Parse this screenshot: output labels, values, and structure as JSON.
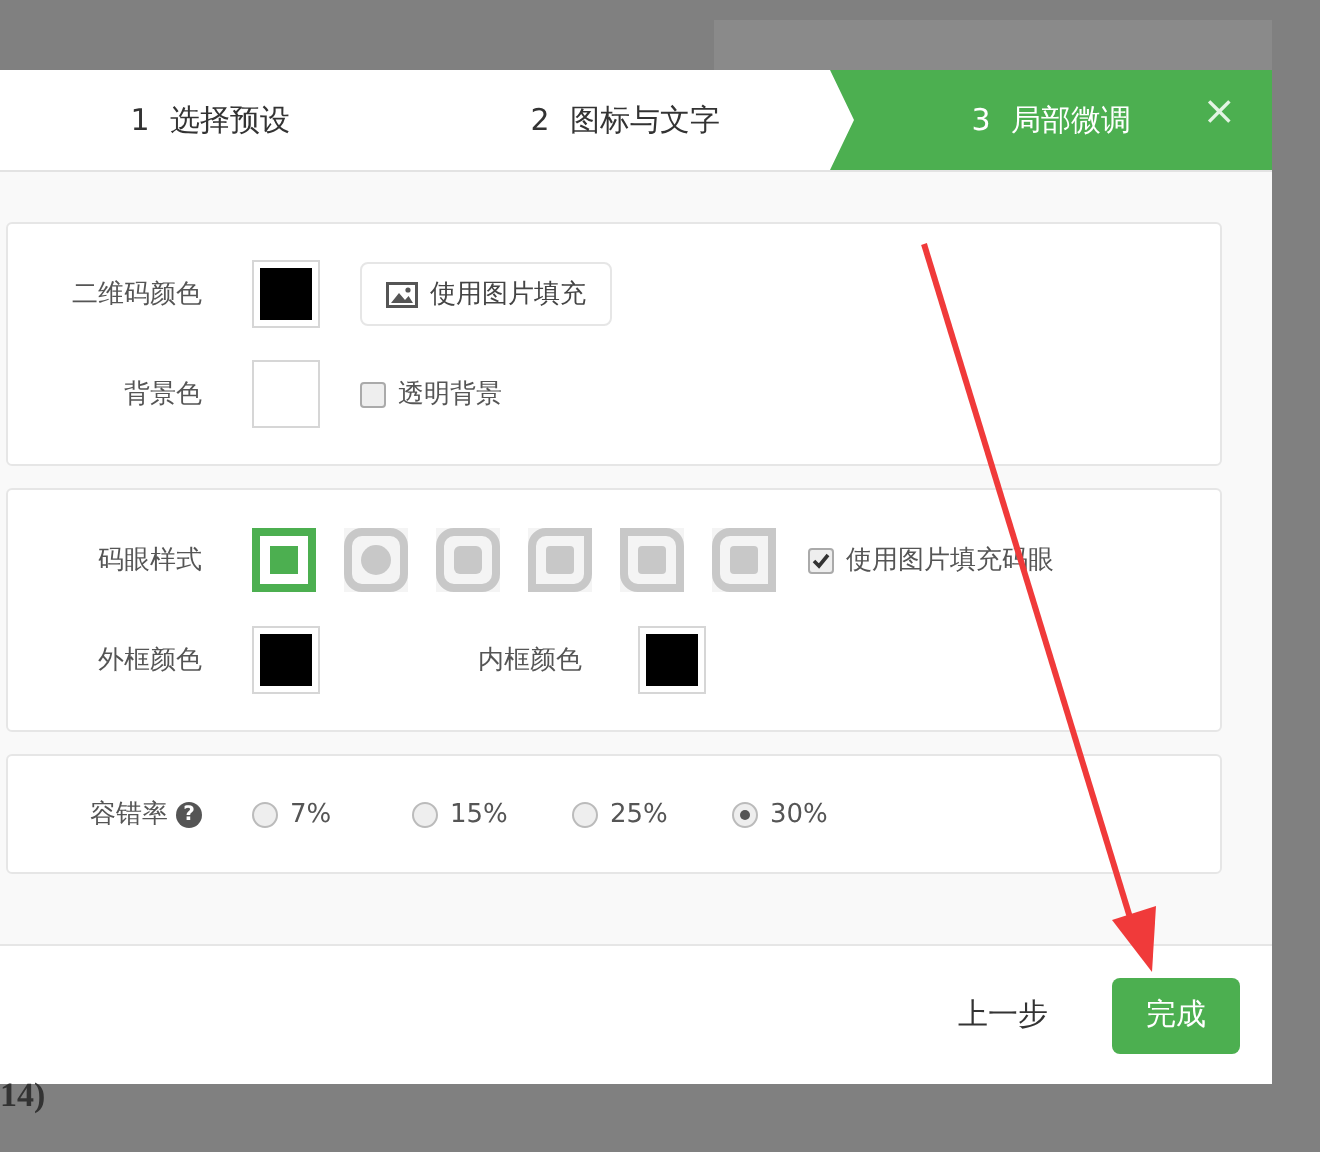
{
  "steps": [
    {
      "number": "1",
      "label": "选择预设",
      "selected": false
    },
    {
      "number": "2",
      "label": "图标与文字",
      "selected": false
    },
    {
      "number": "3",
      "label": "局部微调",
      "selected": true
    }
  ],
  "close": "×",
  "color_panel": {
    "qr_color_label": "二维码颜色",
    "qr_swatch": {
      "color": "#000000"
    },
    "image_fill_button": "使用图片填充",
    "bg_label": "背景色",
    "bg_swatch": {
      "color": "#ffffff"
    },
    "transparent": {
      "label": "透明背景",
      "checked": false
    }
  },
  "eye_panel": {
    "style_label": "码眼样式",
    "styles": [
      {
        "kind": "square",
        "selected": true
      },
      {
        "kind": "circle",
        "selected": false
      },
      {
        "kind": "rounded",
        "selected": false
      },
      {
        "kind": "leaf-br",
        "selected": false
      },
      {
        "kind": "leaf-bl",
        "selected": false
      },
      {
        "kind": "leaf-tr",
        "selected": false
      }
    ],
    "image_fill": {
      "label": "使用图片填充码眼",
      "checked": true
    },
    "outer_label": "外框颜色",
    "outer_swatch": {
      "color": "#000000"
    },
    "inner_label": "内框颜色",
    "inner_swatch": {
      "color": "#000000"
    }
  },
  "error_panel": {
    "label": "容错率",
    "help": "?",
    "options": [
      {
        "label": "7%",
        "selected": false
      },
      {
        "label": "15%",
        "selected": false
      },
      {
        "label": "25%",
        "selected": false
      },
      {
        "label": "30%",
        "selected": true
      }
    ]
  },
  "footer": {
    "back": "上一步",
    "finish": "完成"
  },
  "behind_text": "14)"
}
